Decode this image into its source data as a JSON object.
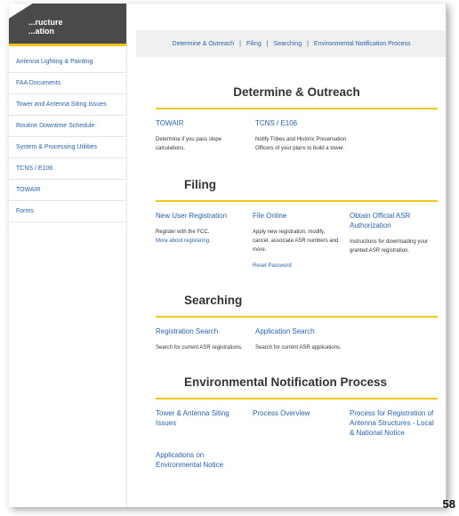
{
  "sidebar": {
    "title_line1": "...ructure",
    "title_line2": "...ation",
    "items": [
      {
        "label": "Antenna Lighting & Painting"
      },
      {
        "label": "FAA Documents"
      },
      {
        "label": "Tower and Antenna Siting Issues"
      },
      {
        "label": "Routine Downtime Schedule"
      },
      {
        "label": "System & Processing Utilities"
      },
      {
        "label": "TCNS / E106"
      },
      {
        "label": "TOWAIR"
      },
      {
        "label": "Forms"
      }
    ]
  },
  "topnav": {
    "items": [
      "Determine & Outreach",
      "Filing",
      "Searching",
      "Environmental Notification Process"
    ],
    "separator": "|"
  },
  "sections": {
    "determine": {
      "title": "Determine & Outreach",
      "towair": {
        "link": "TOWAIR",
        "text": "Determine if you pass slope calculations."
      },
      "tcns": {
        "link": "TCNS / E106",
        "text": "Notify Tribes and Historic Preservation Officers of your plans to build a tower."
      }
    },
    "filing": {
      "title": "Filing",
      "new_user": {
        "link": "New User Registration",
        "text": "Register with the FCC.",
        "sub": "More about registering."
      },
      "file_online": {
        "link": "File Online",
        "text": "Apply new registration, modify, cancel, associate ASR numbers and more.",
        "sub": "Reset Password"
      },
      "obtain": {
        "link": "Obtain Official ASR Authorization",
        "text": "Instructions for downloading your granted ASR registration."
      }
    },
    "searching": {
      "title": "Searching",
      "registration": {
        "link": "Registration Search",
        "text": "Search for current ASR registrations."
      },
      "application": {
        "link": "Application Search",
        "text": "Search for current ASR applications."
      }
    },
    "environmental": {
      "title": "Environmental Notification Process",
      "siting": {
        "link": "Tower & Antenna Siting Issues"
      },
      "overview": {
        "link": "Process Overview"
      },
      "process": {
        "link": "Process for Registration of Antenna Structures - Local & National Notice"
      },
      "applications": {
        "link": "Applications on Environmental Notice"
      }
    }
  },
  "page_number": "58",
  "colors": {
    "accent": "#f5c518",
    "link": "#2a62a8"
  }
}
